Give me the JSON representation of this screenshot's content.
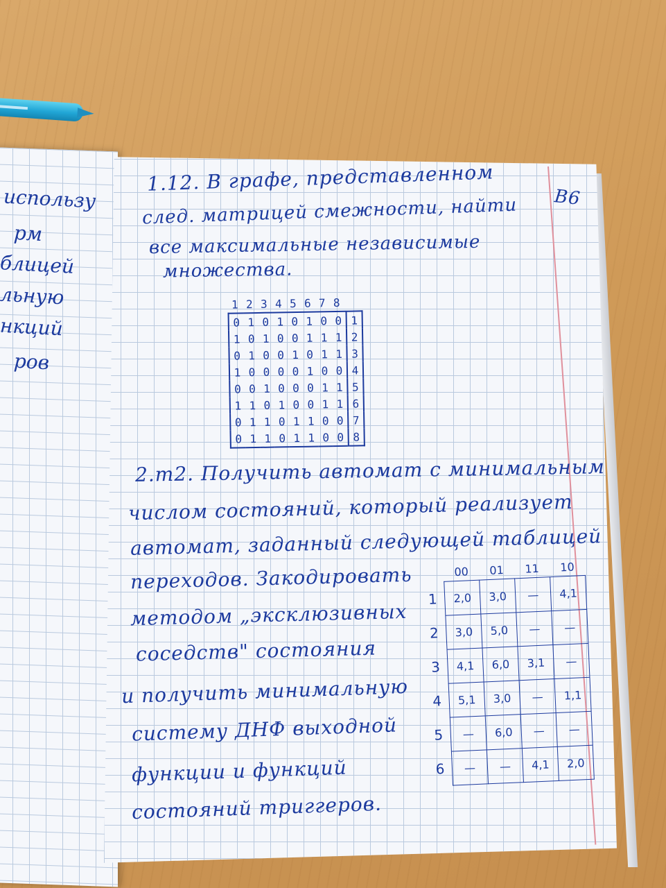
{
  "left_page_lines": [
    "использу",
    "рм",
    "блицей",
    "льную",
    "нкций",
    "ров"
  ],
  "variant": "В6",
  "task1": {
    "lines": [
      "1.12. В графе, представленном",
      "след. матрицей смежности, найти",
      "все максимальные независимые",
      "множества."
    ],
    "col_headers": [
      "1",
      "2",
      "3",
      "4",
      "5",
      "6",
      "7",
      "8"
    ],
    "rows": [
      {
        "label": "1",
        "values": [
          "0",
          "1",
          "0",
          "1",
          "0",
          "1",
          "0",
          "0"
        ]
      },
      {
        "label": "2",
        "values": [
          "1",
          "0",
          "1",
          "0",
          "0",
          "1",
          "1",
          "1"
        ]
      },
      {
        "label": "3",
        "values": [
          "0",
          "1",
          "0",
          "0",
          "1",
          "0",
          "1",
          "1"
        ]
      },
      {
        "label": "4",
        "values": [
          "1",
          "0",
          "0",
          "0",
          "0",
          "1",
          "0",
          "0"
        ]
      },
      {
        "label": "5",
        "values": [
          "0",
          "0",
          "1",
          "0",
          "0",
          "0",
          "1",
          "1"
        ]
      },
      {
        "label": "6",
        "values": [
          "1",
          "1",
          "0",
          "1",
          "0",
          "0",
          "1",
          "1"
        ]
      },
      {
        "label": "7",
        "values": [
          "0",
          "1",
          "1",
          "0",
          "1",
          "1",
          "0",
          "0"
        ]
      },
      {
        "label": "8",
        "values": [
          "0",
          "1",
          "1",
          "0",
          "1",
          "1",
          "0",
          "0"
        ]
      }
    ]
  },
  "task2": {
    "lines": [
      "2.m2. Получить автомат с минимальным",
      "числом состояний, который реализует",
      "автомат, заданный следующей таблицей",
      "переходов. Закодировать",
      "методом „эксклюзивных",
      "соседств\" состояния",
      "и получить минимальную",
      "систему ДНФ выходной",
      "функции и функций",
      "состояний триггеров."
    ],
    "col_headers": [
      "00",
      "01",
      "11",
      "10"
    ],
    "rows": [
      {
        "label": "1",
        "values": [
          "2,0",
          "3,0",
          "—",
          "4,1"
        ]
      },
      {
        "label": "2",
        "values": [
          "3,0",
          "5,0",
          "—",
          "—"
        ]
      },
      {
        "label": "3",
        "values": [
          "4,1",
          "6,0",
          "3,1",
          "—"
        ]
      },
      {
        "label": "4",
        "values": [
          "5,1",
          "3,0",
          "—",
          "1,1"
        ]
      },
      {
        "label": "5",
        "values": [
          "—",
          "6,0",
          "—",
          "—"
        ]
      },
      {
        "label": "6",
        "values": [
          "—",
          "—",
          "4,1",
          "2,0"
        ]
      }
    ]
  }
}
